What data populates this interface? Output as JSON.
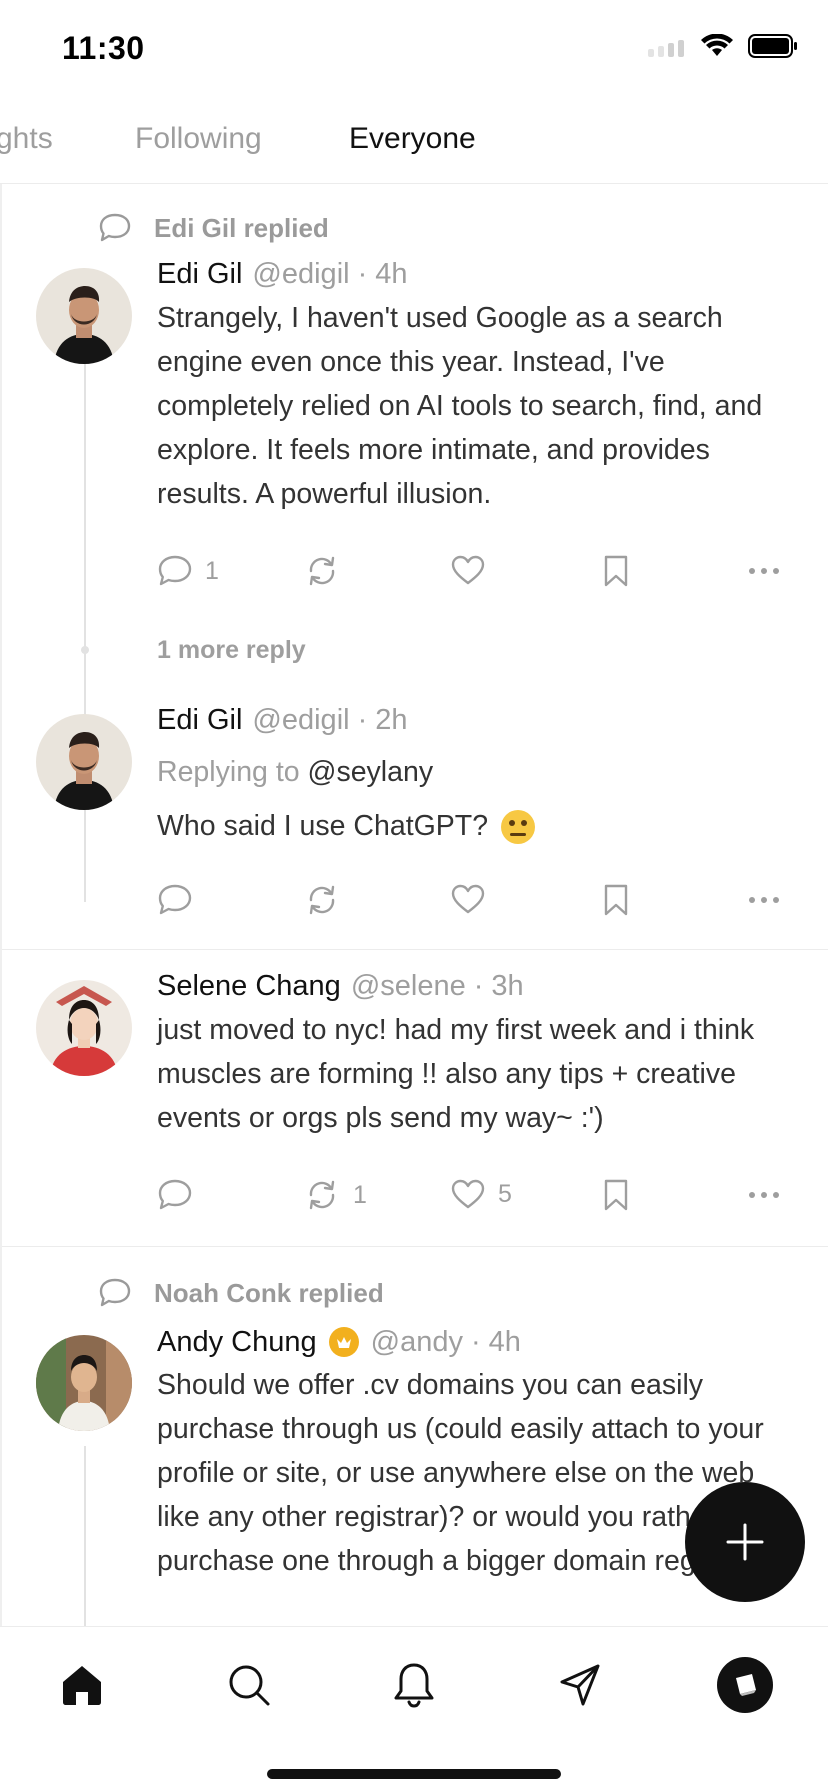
{
  "status_bar": {
    "time": "11:30"
  },
  "tabs": [
    {
      "label": "ghts",
      "active": false
    },
    {
      "label": "Following",
      "active": false
    },
    {
      "label": "Everyone",
      "active": true
    }
  ],
  "posts": [
    {
      "context": "Edi Gil replied",
      "name": "Edi Gil",
      "handle": "@edigil",
      "dot": "·",
      "time": "4h",
      "text": "Strangely, I haven't used Google as a search engine even once this year. Instead, I've completely relied on AI tools to search, find, and explore. It feels more intimate, and provides results. A powerful illusion.",
      "reply_count": "1",
      "more_replies": "1 more reply"
    },
    {
      "name": "Edi Gil",
      "handle": "@edigil",
      "dot": "·",
      "time": "2h",
      "replying_prefix": "Replying to",
      "replying_to": "@seylany",
      "text": "Who said I use ChatGPT?"
    },
    {
      "name": "Selene Chang",
      "handle": "@selene",
      "dot": "·",
      "time": "3h",
      "text": "just moved to nyc! had my first week and i think muscles are forming !! also any tips + creative events or orgs pls send my way~ :')",
      "repost_count": "1",
      "like_count": "5"
    },
    {
      "context": "Noah Conk replied",
      "name": "Andy Chung",
      "handle": "@andy",
      "dot": "·",
      "time": "4h",
      "text": "Should we offer .cv domains you can easily purchase through us (could easily attach to your profile or site, or use anywhere else on the web like any other registrar)? or would you rather just purchase one through a bigger domain registrar?"
    }
  ],
  "colors": {
    "accent": "#111111",
    "muted": "#9e9e9e",
    "verified": "#f2b01e"
  }
}
